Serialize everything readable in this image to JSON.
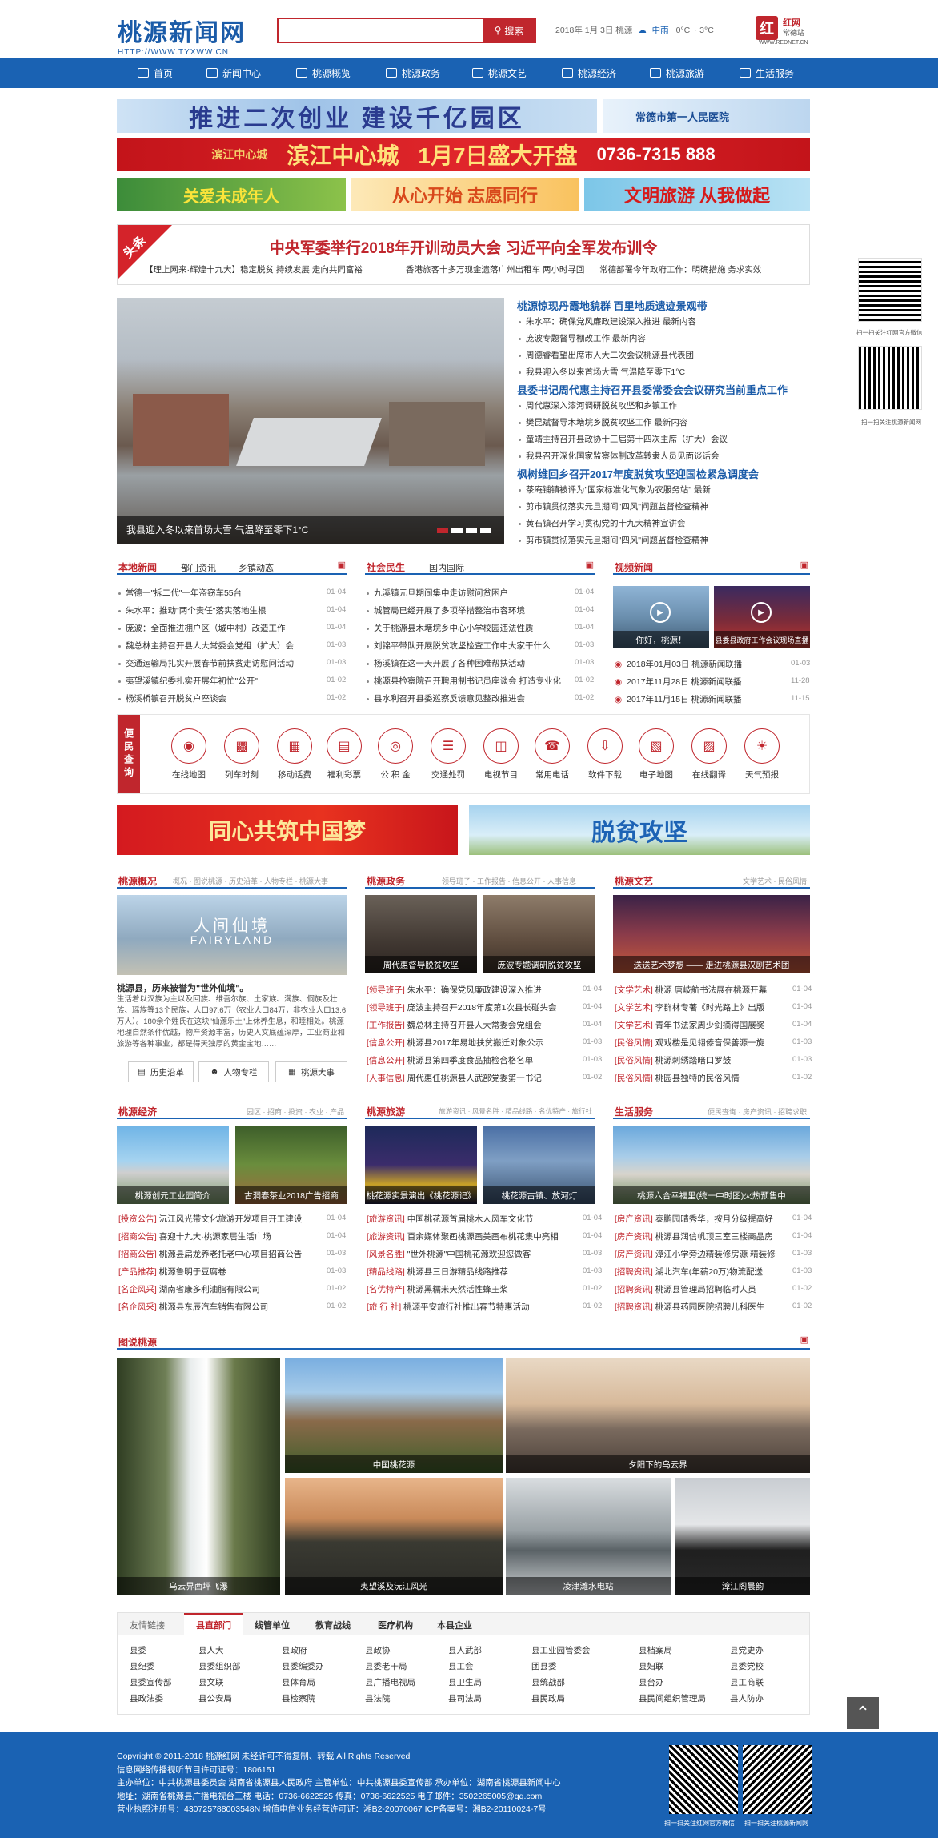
{
  "header": {
    "logo_cn": "桃源新闻网",
    "logo_url": "HTTP://WWW.TYXWW.CN",
    "search_placeholder": "",
    "search_label": "搜索",
    "date": "2018年 1月 3日 桃源",
    "weather": "中雨",
    "temp": "0°C ~ 3°C",
    "partner": "红网",
    "partner_sub": "常德站",
    "partner_url": "WWW.REDNET.CN"
  },
  "nav": [
    "首页",
    "新闻中心",
    "桃源概览",
    "桃源政务",
    "桃源文艺",
    "桃源经济",
    "桃源旅游",
    "生活服务"
  ],
  "banners": {
    "b1": "推进二次创业 建设千亿园区",
    "b2": "常德市第一人民医院",
    "b3a": "滨江中心城",
    "b3b": "1月7日盛大开盘",
    "b3c": "0736-7315 888",
    "b3_logo": "滨江中心城",
    "b4": "关爱未成年人",
    "b5": "从心开始 志愿同行",
    "b6": "文明旅游 从我做起",
    "b7": "同心共筑中国梦",
    "b8": "脱贫攻坚"
  },
  "headline": {
    "tag": "头条",
    "title": "中央军委举行2018年开训动员大会 习近平向全军发布训令",
    "subs": [
      "【理上网来·辉煌十九大】稳定脱贫 持续发展 走向共同富裕",
      "香港旅客十多万现金遗落广州出租车 两小时寻回",
      "常德部署今年政府工作：明确措施 务求实效"
    ]
  },
  "focus": {
    "caption": "我县迎入冬以来首场大雪 气温降至零下1°C",
    "groups": [
      {
        "title": "桃源惊现丹霞地貌群 百里地质遗迹景观带",
        "items": [
          "朱水平：确保党风廉政建设深入推进 最新内容",
          "庞波专题督导棚改工作 最新内容",
          "周德睿看望出席市人大二次会议桃源县代表团",
          "我县迎入冬以来首场大雪 气温降至零下1°C"
        ]
      },
      {
        "title": "县委书记周代惠主持召开县委常委会会议研究当前重点工作",
        "items": [
          "周代惠深入漆河调研脱贫攻坚和乡镇工作",
          "樊昆斌督导木塘垸乡脱贫攻坚工作 最新内容",
          "童靖主持召开县政协十三届第十四次主席（扩大）会议",
          "我县召开深化国家监察体制改革转隶人员见面谈话会"
        ]
      },
      {
        "title": "枫树维回乡召开2017年度脱贫攻坚迎国检紧急调度会",
        "items": [
          "茶庵铺镇被评为\"国家标准化气象为农服务站\" 最新",
          "剪市镇贯彻落实元旦期间\"四风\"问题监督检查精神",
          "黄石镇召开学习贯彻党的十九大精神宣讲会",
          "剪市镇贯彻落实元旦期间\"四风\"问题监督检查精神"
        ]
      }
    ]
  },
  "local": {
    "title": "本地新闻",
    "tabs": [
      "部门资讯",
      "乡镇动态"
    ],
    "items": [
      [
        "常德一\"拆二代\"一年盗窃车55台",
        "01-04"
      ],
      [
        "朱水平：推动\"两个责任\"落实落地生根",
        "01-04"
      ],
      [
        "庞波：全面推进棚户区（城中村）改造工作",
        "01-04"
      ],
      [
        "魏总林主持召开县人大常委会党组（扩大）会",
        "01-03"
      ],
      [
        "交通运输局扎实开展春节前扶贫走访慰问活动",
        "01-03"
      ],
      [
        "夷望溪镇纪委扎实开展年初忙\"公开\"",
        "01-02"
      ],
      [
        "杨溪桥镇召开脱贫户座谈会",
        "01-02"
      ]
    ]
  },
  "social": {
    "title": "社会民生",
    "tabs": [
      "国内国际"
    ],
    "items": [
      [
        "九溪镇元旦期间集中走访慰问贫困户",
        "01-04"
      ],
      [
        "城管局已经开展了多项举措整治市容环境",
        "01-04"
      ],
      [
        "关于桃源县木塘垸乡中心小学校园违法性质",
        "01-04"
      ],
      [
        "刘锦平带队开展脱贫攻坚检查工作中大家干什么",
        "01-03"
      ],
      [
        "杨溪镇在这一天开展了各种困难帮扶活动",
        "01-03"
      ],
      [
        "桃源县检察院召开聘用制书记员座谈会 打造专业化",
        "01-02"
      ],
      [
        "县水利召开县委巡察反馈意见整改推进会",
        "01-02"
      ]
    ]
  },
  "video": {
    "title": "视频新闻",
    "thumbs": [
      "你好，桃源！",
      "县委县政府工作会议现场直播"
    ],
    "items": [
      [
        "2018年01月03日 桃源新闻联播",
        "01-03"
      ],
      [
        "2017年11月28日 桃源新闻联播",
        "11-28"
      ],
      [
        "2017年11月15日 桃源新闻联播",
        "11-15"
      ]
    ]
  },
  "services": {
    "label": "便民查询",
    "items": [
      "在线地图",
      "列车时刻",
      "移动话费",
      "福利彩票",
      "公 积 金",
      "交通处罚",
      "电视节目",
      "常用电话",
      "软件下载",
      "电子地图",
      "在线翻译",
      "天气预报"
    ]
  },
  "overview": {
    "title": "桃源概况",
    "tabs": "概况 · 图说桃源 · 历史沿革 · 人物专栏 · 桃源大事",
    "img_cap": "人间仙境",
    "img_sub": "FAIRYLAND",
    "intro_title": "桃源县，历来被誉为\"世外仙境\"。",
    "intro": "生活着以汉族为主以及回族、维吾尔族、土家族、满族、侗族及壮族、瑶族等13个民族，人口97.6万（农业人口84万，非农业人口13.6万人）。180余个姓氏在这块\"仙源乐土\"上休养生息，和睦相处。桃源地理自然条件优越，物产资源丰富，历史人文底蕴深厚，工业商业和旅游等各种事业，都是得天独厚的黄金宝地……",
    "buttons": [
      "历史沿革",
      "人物专栏",
      "桃源大事"
    ]
  },
  "gov": {
    "title": "桃源政务",
    "tabs": "领导班子 · 工作报告 · 信息公开 · 人事信息",
    "photos": [
      "周代惠督导脱贫攻坚",
      "庞波专题调研脱贫攻坚"
    ],
    "items": [
      [
        "[领导班子]",
        "朱水平：确保党风廉政建设深入推进",
        "01-04"
      ],
      [
        "[领导班子]",
        "庞波主持召开2018年度第1次县长碰头会",
        "01-04"
      ],
      [
        "[工作报告]",
        "魏总林主持召开县人大常委会党组会",
        "01-04"
      ],
      [
        "[信息公开]",
        "桃源县2017年易地扶贫搬迁对象公示",
        "01-03"
      ],
      [
        "[信息公开]",
        "桃源县第四季度食品抽检合格名单",
        "01-03"
      ],
      [
        "[人事信息]",
        "周代惠任桃源县人武部党委第一书记",
        "01-02"
      ]
    ]
  },
  "arts": {
    "title": "桃源文艺",
    "tabs": "文学艺术 · 民俗风情",
    "photo": "送送艺术梦想 —— 走进桃源县汉剧艺术团",
    "items": [
      [
        "[文学艺术]",
        "桃源 唐岐航书法展在桃源开幕",
        "01-04"
      ],
      [
        "[文学艺术]",
        "李群林专著《时光路上》出版",
        "01-04"
      ],
      [
        "[文学艺术]",
        "青年书法家周少剑摘得国展奖",
        "01-04"
      ],
      [
        "[民俗风情]",
        "观戏楼是见翎傣音保善源一旋",
        "01-03"
      ],
      [
        "[民俗风情]",
        "桃源刺绣踏暗口罗鼓",
        "01-03"
      ],
      [
        "[民俗风情]",
        "桃园县独特的民俗风情",
        "01-02"
      ]
    ]
  },
  "economy": {
    "title": "桃源经济",
    "tabs": "园区 · 招商 · 投资 · 农业 · 产品",
    "photos": [
      "桃源创元工业园简介",
      "古洞春茶业2018广告招商"
    ],
    "items": [
      [
        "[投资公告]",
        "沅江风光带文化旅游开发项目开工建设",
        "01-04"
      ],
      [
        "[招商公告]",
        "喜迎十九大·桃源家居生活广场",
        "01-04"
      ],
      [
        "[招商公告]",
        "桃源县扁龙养老托老中心项目招商公告",
        "01-03"
      ],
      [
        "[产品推荐]",
        "桃源鲁明于豆腐卷",
        "01-03"
      ],
      [
        "[名企风采]",
        "湖南省康多利油脂有限公司",
        "01-02"
      ],
      [
        "[名企风采]",
        "桃源县东辰汽车销售有限公司",
        "01-02"
      ]
    ]
  },
  "tourism": {
    "title": "桃源旅游",
    "tabs": "旅游资讯 · 风景名胜 · 精品线路 · 名优特产 · 旅行社",
    "photos": [
      "桃花源实景演出《桃花源记》",
      "桃花源古镇、放河灯"
    ],
    "items": [
      [
        "[旅游资讯]",
        "中国桃花源首届桃木人风车文化节",
        "01-04"
      ],
      [
        "[旅游资讯]",
        "百余媒体聚画桃源画美画布桃花集中亮相",
        "01-04"
      ],
      [
        "[风景名胜]",
        "\"世外桃源\"中国桃花源欢迎您做客",
        "01-03"
      ],
      [
        "[精品线路]",
        "桃源县三日游精品线路推荐",
        "01-03"
      ],
      [
        "[名优特产]",
        "桃源黑糯米天然活性蜂王浆",
        "01-02"
      ],
      [
        "[旅 行 社]",
        "桃源平安旅行社推出春节特惠活动",
        "01-02"
      ]
    ]
  },
  "life": {
    "title": "生活服务",
    "tabs": "便民查询 · 房产资讯 · 招聘求职",
    "photo": "桃源六合幸福里(统一中时图)火热预售中",
    "items": [
      [
        "[房产资讯]",
        "泰鹏园晴秀华，按月分级提高好",
        "01-04"
      ],
      [
        "[房产资讯]",
        "桃源县润信帆顶三室三楼商品房",
        "01-04"
      ],
      [
        "[房产资讯]",
        "漳江小学旁边精装修房源 精装修",
        "01-03"
      ],
      [
        "[招聘资讯]",
        "湖北汽车(年薪20万)物流配送",
        "01-03"
      ],
      [
        "[招聘资讯]",
        "桃源县管理局招聘临时人员",
        "01-02"
      ],
      [
        "[招聘资讯]",
        "桃源县药园医院招聘儿科医生",
        "01-02"
      ]
    ]
  },
  "gallery": {
    "title": "图说桃源",
    "photos": [
      "乌云界西坪飞瀑",
      "中国桃花源",
      "夕阳下的乌云界",
      "夷望溪及沅江风光",
      "凌津滩水电站",
      "漳江阁晨韵"
    ]
  },
  "links": {
    "tabs": [
      "友情链接",
      "县直部门",
      "线管单位",
      "教育战线",
      "医疗机构",
      "本县企业"
    ],
    "rows": [
      [
        "县委",
        "县人大",
        "县政府",
        "县政协",
        "县人武部",
        "县工业园管委会",
        "县档案局",
        "县党史办"
      ],
      [
        "县纪委",
        "县委组织部",
        "县委编委办",
        "县委老干局",
        "县工会",
        "团县委",
        "县妇联",
        "县委党校"
      ],
      [
        "县委宣传部",
        "县文联",
        "县体育局",
        "县广播电视局",
        "县卫生局",
        "县统战部",
        "县台办",
        "县工商联"
      ],
      [
        "县政法委",
        "县公安局",
        "县检察院",
        "县法院",
        "县司法局",
        "县民政局",
        "县民间组织管理局",
        "县人防办"
      ]
    ]
  },
  "footer": {
    "lines": [
      "Copyright © 2011-2018 桃源红网 未经许可不得复制、转载 All Rights Reserved",
      "信息网络传播视听节目许可证号：1806151",
      "主办单位：中共桃源县委员会 湖南省桃源县人民政府  主管单位：中共桃源县委宣传部  承办单位：湖南省桃源县新闻中心",
      "地址：湖南省桃源县广播电视台三楼    电话：0736-6622525    传真：0736-6622525    电子邮件：3502265005@qq.com",
      "营业执照注册号：430725788003548N 增值电信业务经营许可证：湘B2-20070067 ICP备案号：湘B2-20110024-7号"
    ],
    "qr1": "扫一扫关注红网官方微信",
    "qr2": "扫一扫关注桃源新闻网",
    "side_qr1": "扫一扫关注红网官方微信",
    "side_qr2": "扫一扫关注桃源新闻网"
  }
}
